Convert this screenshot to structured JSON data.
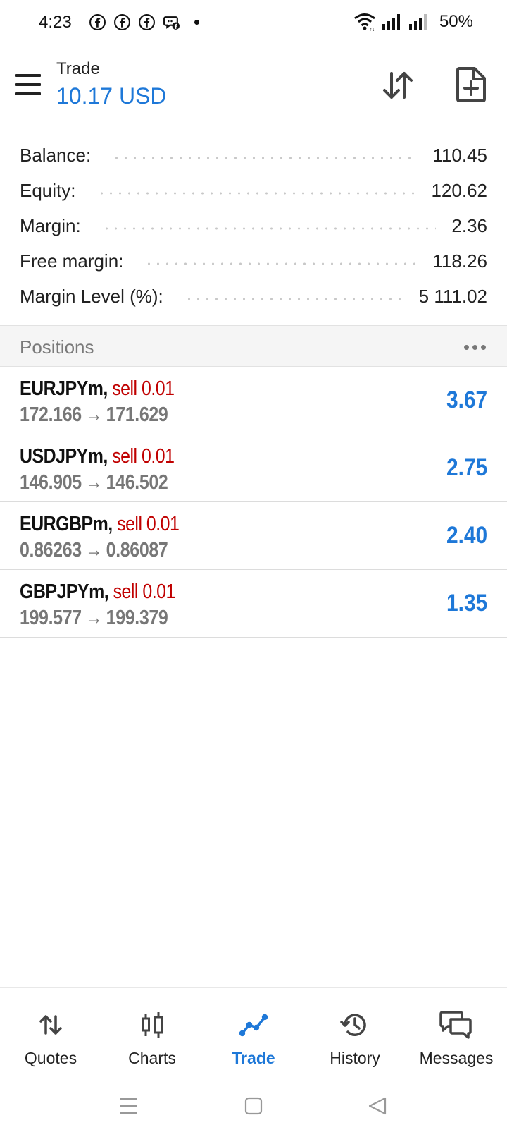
{
  "status_bar": {
    "time": "4:23",
    "battery": "50%",
    "icons": [
      "facebook-icon",
      "facebook-icon",
      "facebook-icon",
      "messenger-icon",
      "notification-dot",
      "wifi-icon",
      "signal-icon",
      "signal-icon"
    ]
  },
  "header": {
    "title": "Trade",
    "balance": "10.17 USD"
  },
  "summary": [
    {
      "label": "Balance:",
      "value": "110.45"
    },
    {
      "label": "Equity:",
      "value": "120.62"
    },
    {
      "label": "Margin:",
      "value": "2.36"
    },
    {
      "label": "Free margin:",
      "value": "118.26"
    },
    {
      "label": "Margin Level (%):",
      "value": "5 111.02"
    }
  ],
  "positions": {
    "title": "Positions",
    "items": [
      {
        "symbol": "EURJPYm,",
        "type": "sell 0.01",
        "open": "172.166",
        "arrow": "→",
        "current": "171.629",
        "profit": "3.67"
      },
      {
        "symbol": "USDJPYm,",
        "type": "sell 0.01",
        "open": "146.905",
        "arrow": "→",
        "current": "146.502",
        "profit": "2.75"
      },
      {
        "symbol": "EURGBPm,",
        "type": "sell 0.01",
        "open": "0.86263",
        "arrow": "→",
        "current": "0.86087",
        "profit": "2.40"
      },
      {
        "symbol": "GBPJPYm,",
        "type": "sell 0.01",
        "open": "199.577",
        "arrow": "→",
        "current": "199.379",
        "profit": "1.35"
      }
    ]
  },
  "bottom_nav": [
    {
      "label": "Quotes",
      "icon": "quotes-arrows-icon",
      "active": false
    },
    {
      "label": "Charts",
      "icon": "candlestick-icon",
      "active": false
    },
    {
      "label": "Trade",
      "icon": "trend-line-icon",
      "active": true
    },
    {
      "label": "History",
      "icon": "history-icon",
      "active": false
    },
    {
      "label": "Messages",
      "icon": "messages-icon",
      "active": false
    }
  ],
  "colors": {
    "accent": "#1e78d8",
    "sell": "#c00000",
    "muted": "#777777"
  }
}
